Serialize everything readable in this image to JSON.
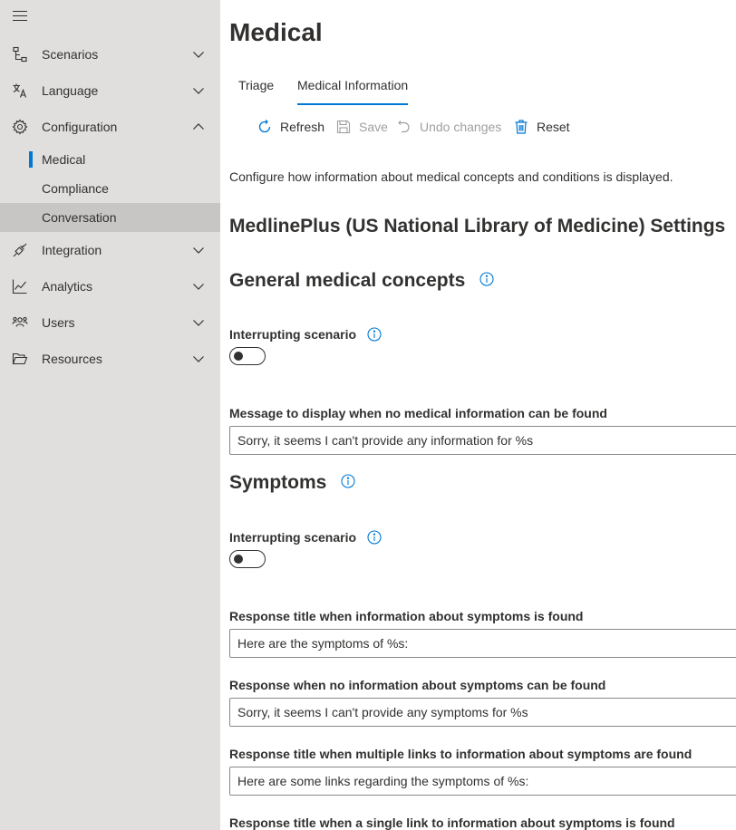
{
  "sidebar": {
    "items": [
      {
        "label": "Scenarios",
        "icon": "scenarios-icon"
      },
      {
        "label": "Language",
        "icon": "language-icon"
      },
      {
        "label": "Configuration",
        "icon": "gear-icon"
      },
      {
        "label": "Integration",
        "icon": "plug-icon"
      },
      {
        "label": "Analytics",
        "icon": "chart-icon"
      },
      {
        "label": "Users",
        "icon": "users-icon"
      },
      {
        "label": "Resources",
        "icon": "folder-icon"
      }
    ],
    "sub_items": [
      {
        "label": "Medical"
      },
      {
        "label": "Compliance"
      },
      {
        "label": "Conversation"
      }
    ]
  },
  "page": {
    "title": "Medical",
    "tabs": [
      {
        "label": "Triage"
      },
      {
        "label": "Medical Information"
      }
    ],
    "commands": {
      "refresh": "Refresh",
      "save": "Save",
      "undo": "Undo changes",
      "reset": "Reset"
    },
    "description": "Configure how information about medical concepts and conditions is displayed.",
    "section_title": "MedlinePlus (US National Library of Medicine) Settings",
    "general": {
      "heading": "General medical concepts",
      "interrupting_label": "Interrupting scenario",
      "interrupting_on": false,
      "message_label": "Message to display when no medical information can be found",
      "message_value": "Sorry, it seems I can't provide any information for %s"
    },
    "symptoms": {
      "heading": "Symptoms",
      "interrupting_label": "Interrupting scenario",
      "interrupting_on": false,
      "found_title_label": "Response title when information about symptoms is found",
      "found_title_value": "Here are the symptoms of %s:",
      "not_found_label": "Response when no information about symptoms can be found",
      "not_found_value": "Sorry, it seems I can't provide any symptoms for %s",
      "multi_links_label": "Response title when multiple links to information about symptoms are found",
      "multi_links_value": "Here are some links regarding the symptoms of %s:",
      "single_link_label": "Response title when a single link to information about symptoms is found"
    }
  },
  "colors": {
    "accent": "#0078d4",
    "sidebar_bg": "#e1dfdd",
    "selected_bg": "#c8c6c4",
    "disabled_text": "#a19f9d"
  }
}
